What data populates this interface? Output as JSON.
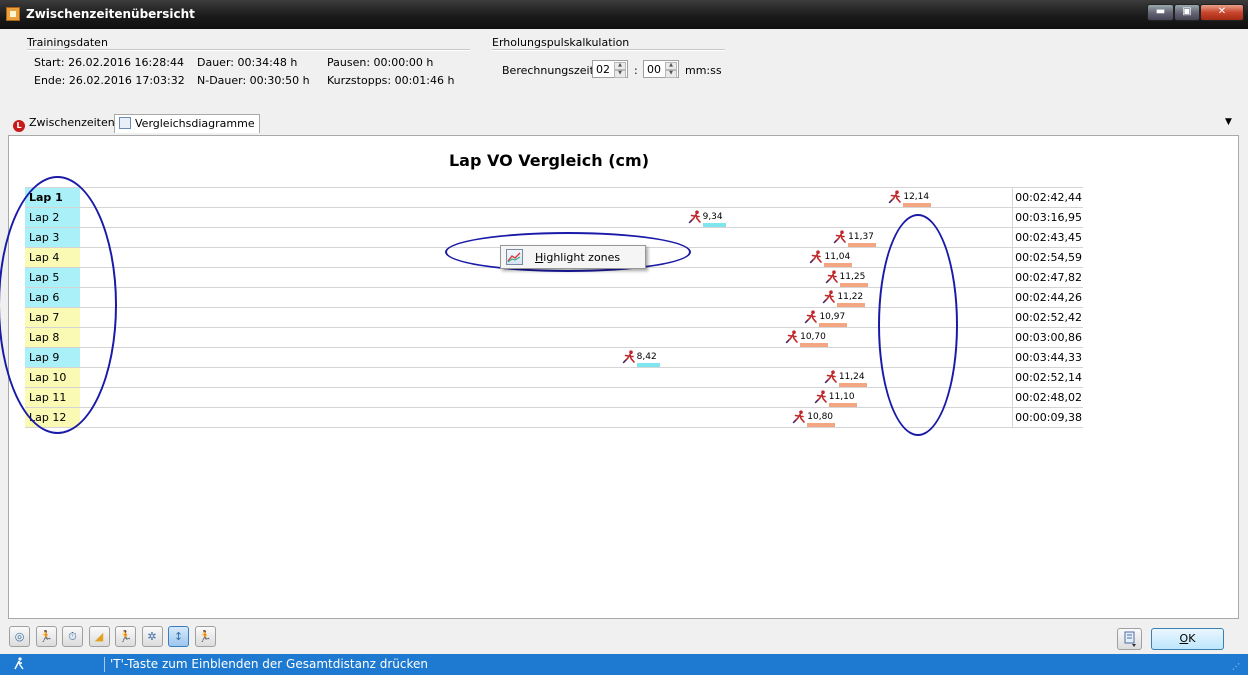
{
  "window": {
    "title": "Zwischenzeitenübersicht",
    "minimize_label": "▬",
    "maximize_label": "▣",
    "close_label": "✕"
  },
  "training": {
    "group_title": "Trainingsdaten",
    "start": "Start: 26.02.2016 16:28:44",
    "ende": "Ende: 26.02.2016 17:03:32",
    "dauer": "Dauer: 00:34:48 h",
    "n_dauer": "N-Dauer: 00:30:50 h",
    "pausen": "Pausen: 00:00:00 h",
    "kurzstopps": "Kurzstopps: 00:01:46 h"
  },
  "recovery": {
    "group_title": "Erholungspulskalkulation",
    "label": "Berechnungszeit",
    "minutes": "02",
    "separator": ":",
    "seconds": "00",
    "unit": "mm:ss"
  },
  "tabs": [
    {
      "label": "Zwischenzeiten",
      "icon": "lap-icon",
      "active": false
    },
    {
      "label": "Vergleichsdiagramme",
      "icon": "chart-icon",
      "active": true
    }
  ],
  "colors": {
    "cyan": "#aaf0f8",
    "yellow": "#fafab4",
    "bar": "#f4a582",
    "bar_cyan": "#7fe6f0",
    "accent": "#1e7ad0"
  },
  "chart_data": {
    "type": "table",
    "title": "Lap VO Vergleich (cm)",
    "xlim": [
      0,
      13
    ],
    "laps": [
      {
        "label": "Lap 1",
        "value": 12.14,
        "value_text": "12,14",
        "time": "00:02:42,44",
        "color": "cyan",
        "bold": true
      },
      {
        "label": "Lap 2",
        "value": 9.34,
        "value_text": "9,34",
        "time": "00:03:16,95",
        "color": "cyan",
        "bold": false
      },
      {
        "label": "Lap 3",
        "value": 11.37,
        "value_text": "11,37",
        "time": "00:02:43,45",
        "color": "cyan",
        "bold": false
      },
      {
        "label": "Lap 4",
        "value": 11.04,
        "value_text": "11,04",
        "time": "00:02:54,59",
        "color": "yellow",
        "bold": false
      },
      {
        "label": "Lap 5",
        "value": 11.25,
        "value_text": "11,25",
        "time": "00:02:47,82",
        "color": "cyan",
        "bold": false
      },
      {
        "label": "Lap 6",
        "value": 11.22,
        "value_text": "11,22",
        "time": "00:02:44,26",
        "color": "cyan",
        "bold": false
      },
      {
        "label": "Lap 7",
        "value": 10.97,
        "value_text": "10,97",
        "time": "00:02:52,42",
        "color": "yellow",
        "bold": false
      },
      {
        "label": "Lap 8",
        "value": 10.7,
        "value_text": "10,70",
        "time": "00:03:00,86",
        "color": "yellow",
        "bold": false
      },
      {
        "label": "Lap 9",
        "value": 8.42,
        "value_text": "8,42",
        "time": "00:03:44,33",
        "color": "cyan",
        "bold": false
      },
      {
        "label": "Lap 10",
        "value": 11.24,
        "value_text": "11,24",
        "time": "00:02:52,14",
        "color": "yellow",
        "bold": false
      },
      {
        "label": "Lap 11",
        "value": 11.1,
        "value_text": "11,10",
        "time": "00:02:48,02",
        "color": "yellow",
        "bold": false
      },
      {
        "label": "Lap 12",
        "value": 10.8,
        "value_text": "10,80",
        "time": "00:00:09,38",
        "color": "yellow",
        "bold": false
      }
    ]
  },
  "context_menu": {
    "label_hotkey": "H",
    "label_rest": "ighlight zones",
    "icon": "zones-chart-icon"
  },
  "toolbar": {
    "buttons": [
      {
        "name": "speedometer-icon",
        "glyph": "◎"
      },
      {
        "name": "runner-icon",
        "glyph": "🏃"
      },
      {
        "name": "stopwatch-icon",
        "glyph": "⏱"
      },
      {
        "name": "elevation-icon",
        "glyph": "◢"
      },
      {
        "name": "runner-step-icon",
        "glyph": "🏃"
      },
      {
        "name": "gear-icon",
        "glyph": "✲"
      },
      {
        "name": "vertical-oscillation-icon",
        "glyph": "↕"
      },
      {
        "name": "runner-compare-icon",
        "glyph": "🏃"
      }
    ],
    "active_index": 6
  },
  "footer": {
    "ok_hotkey": "O",
    "ok_rest": "K"
  },
  "status": {
    "icon": "runner-icon",
    "text": "'T'-Taste zum Einblenden der Gesamtdistanz drücken"
  }
}
